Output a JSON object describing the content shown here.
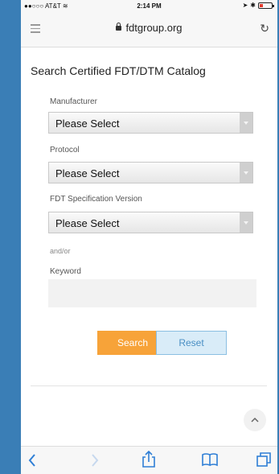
{
  "status_bar": {
    "carrier": "●●○○○ AT&T",
    "time": "2:14 PM"
  },
  "browser": {
    "url": "fdtgroup.org"
  },
  "page": {
    "title": "Search Certified FDT/DTM Catalog",
    "fields": [
      {
        "label": "Manufacturer",
        "value": "Please Select"
      },
      {
        "label": "Protocol",
        "value": "Please Select"
      },
      {
        "label": "FDT Specification Version",
        "value": "Please Select"
      }
    ],
    "and_or": "and/or",
    "keyword_label": "Keyword",
    "keyword_value": "",
    "search_label": "Search",
    "reset_label": "Reset"
  },
  "colors": {
    "background": "#3a7eb6",
    "search_button": "#f7a339",
    "reset_button": "#d9ecf8",
    "battery": "#e23b2e"
  },
  "icons": {
    "status": [
      "wifi-icon",
      "location-icon",
      "bluetooth-icon",
      "battery-icon"
    ],
    "browser": [
      "menu-icon",
      "lock-icon",
      "reload-icon"
    ],
    "toolbar": [
      "back-icon",
      "forward-icon",
      "share-icon",
      "bookmarks-icon",
      "tabs-icon"
    ],
    "page": [
      "chevron-up-icon"
    ]
  }
}
